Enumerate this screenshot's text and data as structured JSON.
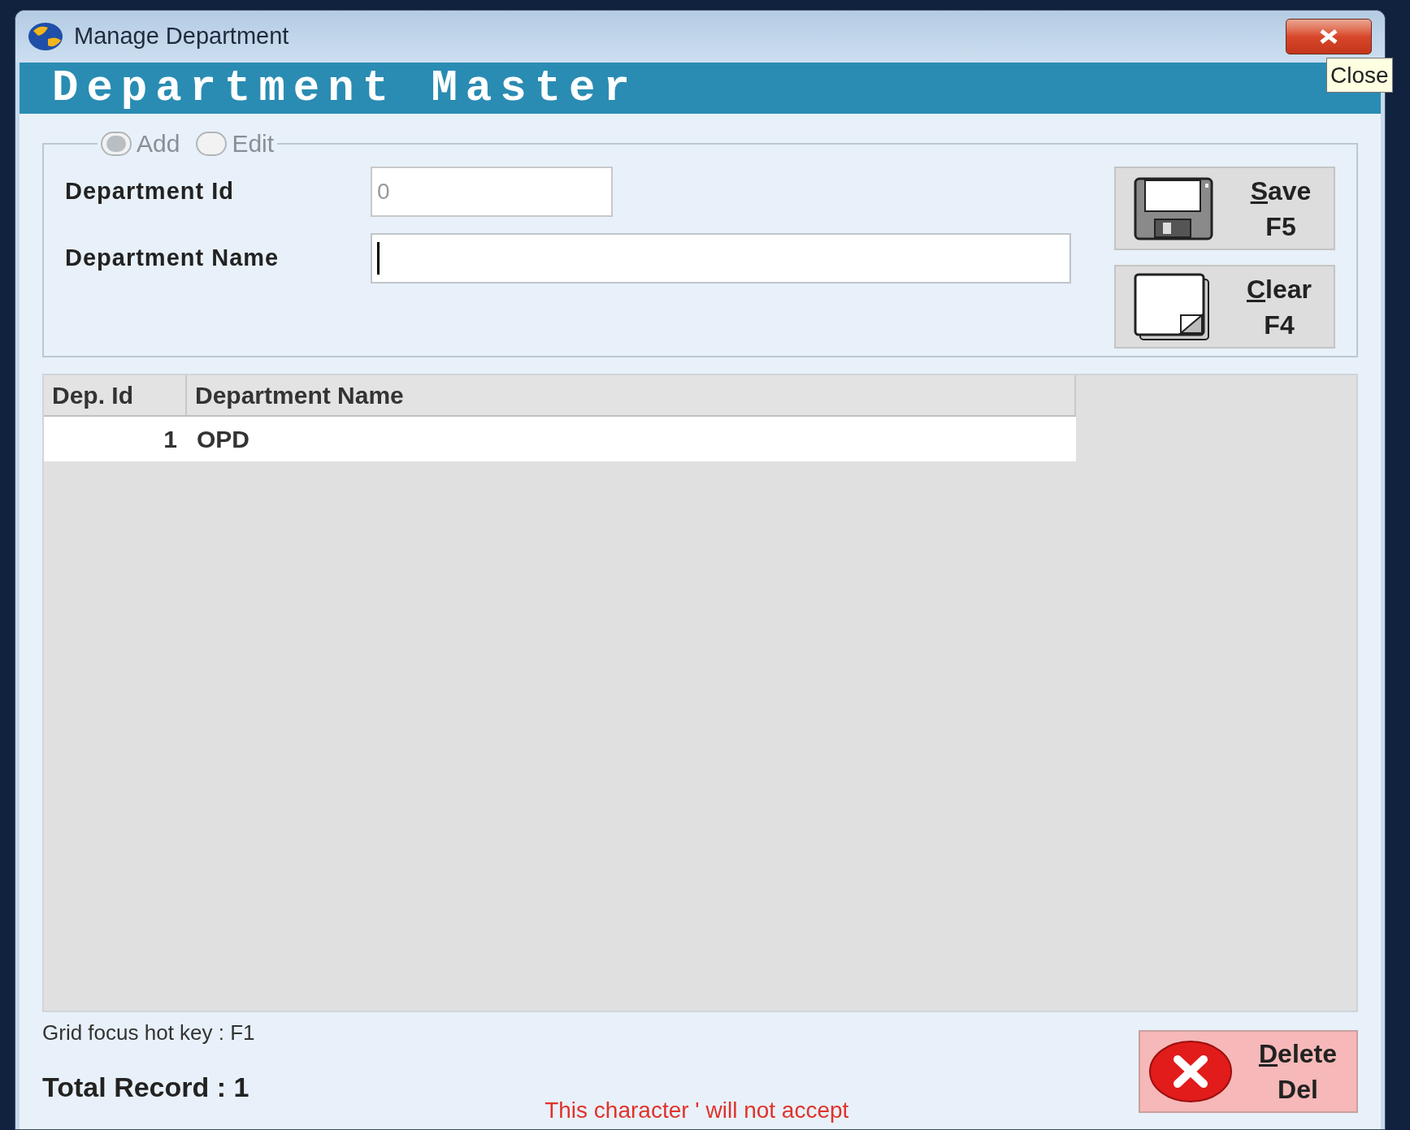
{
  "window": {
    "title": "Manage Department",
    "close_tooltip": "Close"
  },
  "banner": "Department Master",
  "mode_options": [
    {
      "label": "Add",
      "selected": true,
      "disabled": true
    },
    {
      "label": "Edit",
      "selected": false,
      "disabled": true
    }
  ],
  "fields": [
    {
      "label": "Department Id",
      "value": "0",
      "disabled": true,
      "focused": false
    },
    {
      "label": "Department Name",
      "disabled": false,
      "focused": true
    }
  ],
  "buttons": [
    {
      "kind": "save",
      "label": "Save",
      "hotkey": "F5"
    },
    {
      "kind": "clear",
      "label": "Clear",
      "hotkey": "F4"
    }
  ],
  "grid": {
    "columns": [
      "Dep. Id",
      "Department Name"
    ],
    "rows": [
      {
        "cells": [
          "1",
          "OPD"
        ]
      }
    ]
  },
  "hint": "Grid focus hot key : F1",
  "total": "Total Record : 1",
  "message": "This character ' will not accept",
  "delete_button": {
    "label": "Delete",
    "hotkey": "Del"
  }
}
